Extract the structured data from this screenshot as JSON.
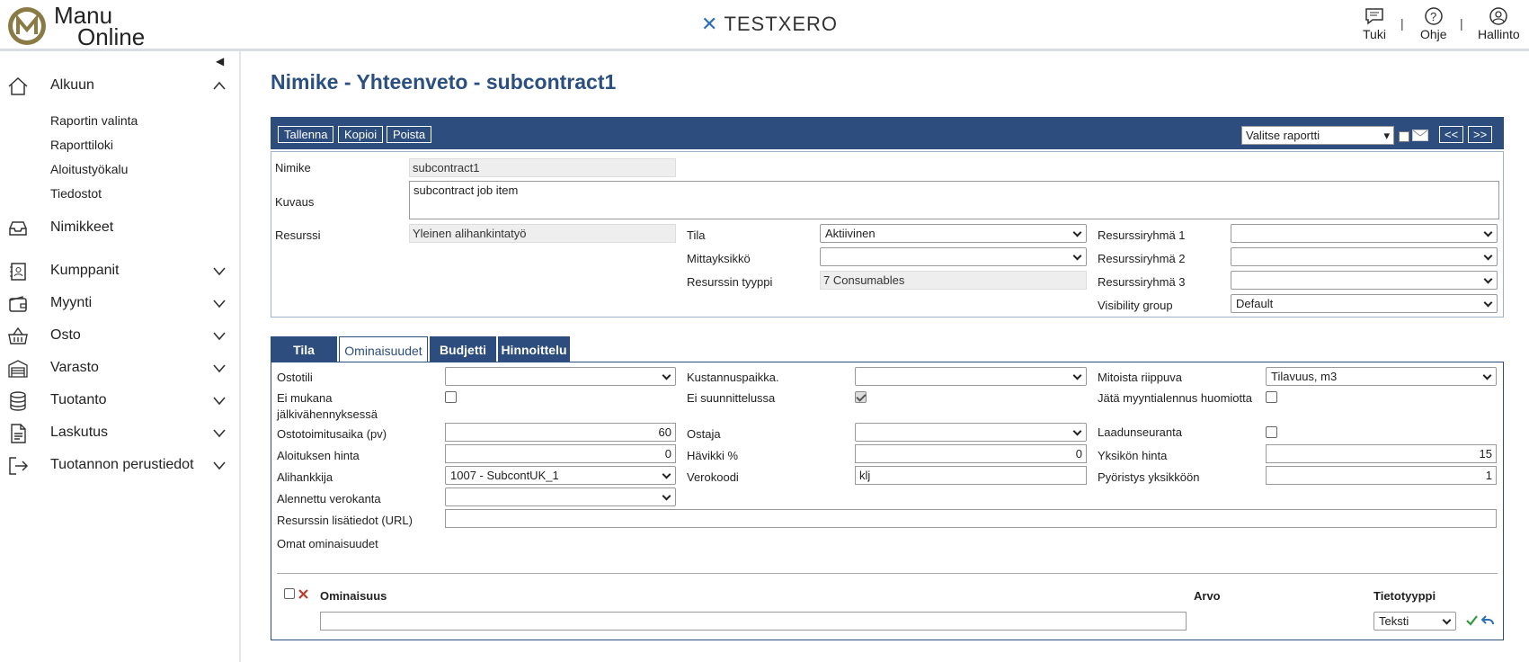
{
  "header": {
    "logo_line1": "Manu",
    "logo_line2": "Online",
    "brand": "TESTXERO",
    "links": [
      {
        "label": "Tuki",
        "icon": "chat-icon"
      },
      {
        "label": "Ohje",
        "icon": "help-icon"
      },
      {
        "label": "Hallinto",
        "icon": "user-icon"
      }
    ]
  },
  "sidebar": {
    "home": "Alkuun",
    "home_sub": [
      "Raportin valinta",
      "Raporttiloki",
      "Aloitustyökalu",
      "Tiedostot"
    ],
    "items": [
      "Nimikkeet",
      "Kumppanit",
      "Myynti",
      "Osto",
      "Varasto",
      "Tuotanto",
      "Laskutus",
      "Tuotannon perustiedot"
    ]
  },
  "page_title": "Nimike - Yhteenveto - subcontract1",
  "toolbar": {
    "save": "Tallenna",
    "copy": "Kopioi",
    "delete": "Poista",
    "report_select": "Valitse raportti",
    "prev": "<<",
    "next": ">>"
  },
  "summary": {
    "nimike_label": "Nimike",
    "nimike_value": "subcontract1",
    "kuvaus_label": "Kuvaus",
    "kuvaus_value": "subcontract job item",
    "resurssi_label": "Resurssi",
    "resurssi_value": "Yleinen alihankintatyö",
    "tila_label": "Tila",
    "tila_value": "Aktiivinen",
    "mittayksikko_label": "Mittayksikkö",
    "mittayksikko_value": "",
    "tyyppi_label": "Resurssin tyyppi",
    "tyyppi_value": "7 Consumables",
    "rg1_label": "Resurssiryhmä 1",
    "rg2_label": "Resurssiryhmä 2",
    "rg3_label": "Resurssiryhmä 3",
    "visibility_label": "Visibility group",
    "visibility_value": "Default"
  },
  "tabs": [
    "Tila",
    "Ominaisuudet",
    "Budjetti",
    "Hinnoittelu"
  ],
  "props": {
    "ostotili": "Ostotili",
    "kustannuspaikka": "Kustannuspaikka.",
    "mitoista": "Mitoista riippuva",
    "mitoista_value": "Tilavuus, m3",
    "ei_mukana_1": "Ei mukana",
    "ei_mukana_2": "jälkivähennyksessä",
    "ei_suunn": "Ei suunnittelussa",
    "jata": "Jätä myyntialennus huomiotta",
    "ostotoim": "Ostotoimitusaika (pv)",
    "ostotoim_value": "60",
    "ostaja": "Ostaja",
    "laadun": "Laadunseuranta",
    "aloit_hinta": "Aloituksen hinta",
    "aloit_hinta_value": "0",
    "havikki": "Hävikki %",
    "havikki_value": "0",
    "yks_hinta": "Yksikön hinta",
    "yks_hinta_value": "15",
    "alihankkija": "Alihankkija",
    "alihankkija_value": "1007 - SubcontUK_1",
    "verokoodi": "Verokoodi",
    "verokoodi_value": "klj",
    "pyoristys": "Pyöristys yksikköön",
    "pyoristys_value": "1",
    "alennettu": "Alennettu verokanta",
    "url": "Resurssin lisätiedot (URL)",
    "omat": "Omat ominaisuudet",
    "col_ominaisuus": "Ominaisuus",
    "col_arvo": "Arvo",
    "col_tietotyyppi": "Tietotyyppi",
    "tietotyyppi_value": "Teksti"
  },
  "colors": {
    "primary": "#2c4d7d",
    "title": "#2a4f80",
    "brand_mark": "#2a6fb7",
    "delete": "#c0392b",
    "ok": "#2e9a3a"
  }
}
